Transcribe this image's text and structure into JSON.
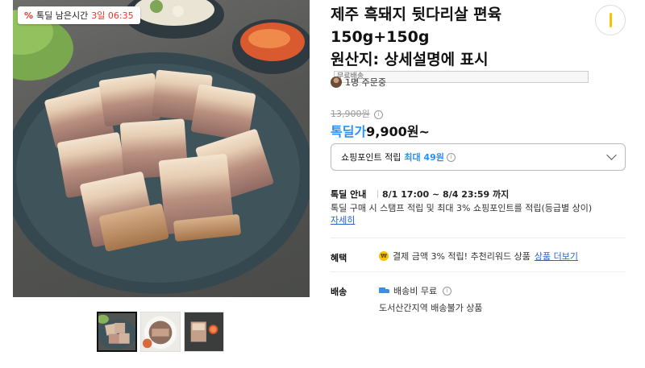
{
  "deal_badge": {
    "label": "톡딜 남은시간",
    "time": "3일 06:35"
  },
  "product": {
    "title_lines": [
      "제주 흑돼지 뒷다리살 편육",
      "150g+150g",
      "원산지: 상세설명에 표시"
    ],
    "free_shipping_tag": "무료배송"
  },
  "orders": {
    "text": "1명 주문중"
  },
  "price": {
    "original": "13,900원",
    "deal_label": "톡딜가",
    "deal_value": "9,900원~"
  },
  "points": {
    "label": "쇼핑포인트 적립",
    "max_text": "최대 49원"
  },
  "talkdeal": {
    "label": "톡딜 안내",
    "period": "8/1 17:00 ~ 8/4 23:59 까지",
    "description": "톡딜 구매 시 스탬프 적립 및 최대 3% 쇼핑포인트를 적립(등급별 상이)",
    "detail_link": "자세히"
  },
  "benefit": {
    "label": "혜택",
    "text": "결제 금액 3% 적립! 추천리워드 상품",
    "link": "상품 더보기"
  },
  "shipping": {
    "label": "배송",
    "fee": "배송비 무료",
    "note": "도서산간지역 배송불가 상품"
  },
  "thumbnails": [
    {
      "name": "sliced-pork-platter"
    },
    {
      "name": "pork-plate-top-view"
    },
    {
      "name": "pork-with-dip-sauce"
    }
  ],
  "colors": {
    "accent_blue": "#2a8ff7",
    "deal_red": "#e8372a",
    "kakao_yellow": "#f5c400"
  }
}
